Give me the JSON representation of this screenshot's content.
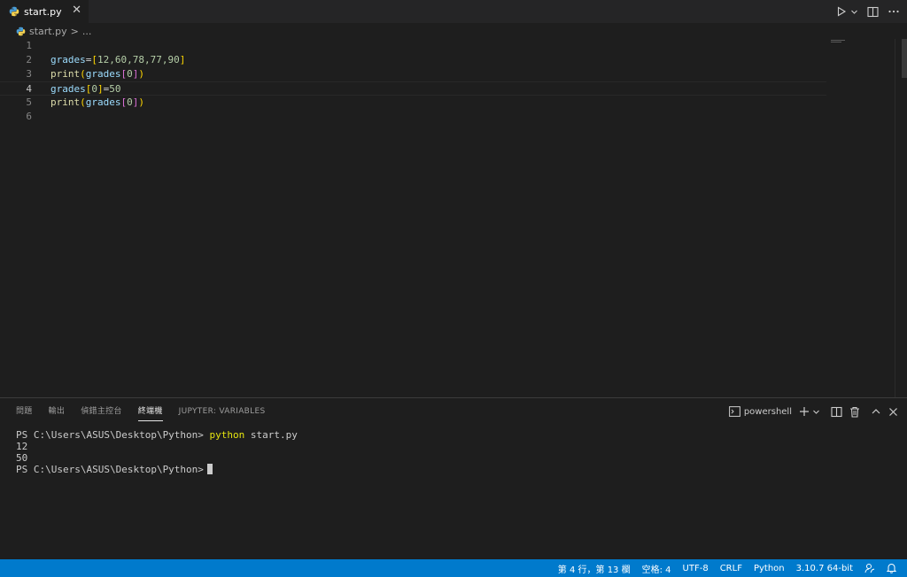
{
  "tab": {
    "filename": "start.py",
    "close": "✕"
  },
  "breadcrumb": {
    "file": "start.py",
    "separator": ">",
    "more": "..."
  },
  "editor": {
    "line_numbers": [
      "1",
      "2",
      "3",
      "4",
      "5",
      "6"
    ],
    "lines": {
      "l2": {
        "var": "grades",
        "eq": "=",
        "open": "[",
        "values": "12,60,78,77,90",
        "close": "]"
      },
      "l3": {
        "fn": "print",
        "open": "(",
        "var": "grades",
        "iopen": "[",
        "idx": "0",
        "iclose": "]",
        "close": ")"
      },
      "l4": {
        "var": "grades",
        "iopen": "[",
        "idx": "0",
        "iclose": "]",
        "eq": "=",
        "val": "50"
      },
      "l5": {
        "fn": "print",
        "open": "(",
        "var": "grades",
        "iopen": "[",
        "idx": "0",
        "iclose": "]",
        "close": ")"
      }
    }
  },
  "panel": {
    "tabs": [
      "問題",
      "輸出",
      "偵錯主控台",
      "終端機",
      "JUPYTER: VARIABLES"
    ],
    "active_tab": "終端機",
    "shell": "powershell"
  },
  "terminal": {
    "prompt": "PS C:\\Users\\ASUS\\Desktop\\Python>",
    "command": "python",
    "command_arg": "start.py",
    "output_1": "12",
    "output_2": "50"
  },
  "status": {
    "position": "第 4 行，第 13 欄",
    "spaces": "空格: 4",
    "encoding": "UTF-8",
    "eol": "CRLF",
    "language": "Python",
    "interpreter": "3.10.7 64-bit"
  },
  "colors": {
    "accent": "#007acc",
    "editor_bg": "#1e1e1e",
    "tab_bg": "#252526"
  },
  "icons": [
    "python-icon",
    "close-icon",
    "run-icon",
    "chevron-down-icon",
    "split-editor-icon",
    "more-icon",
    "terminal-icon",
    "plus-icon",
    "trash-icon",
    "chevron-up-icon",
    "feedback-icon",
    "bell-icon"
  ]
}
